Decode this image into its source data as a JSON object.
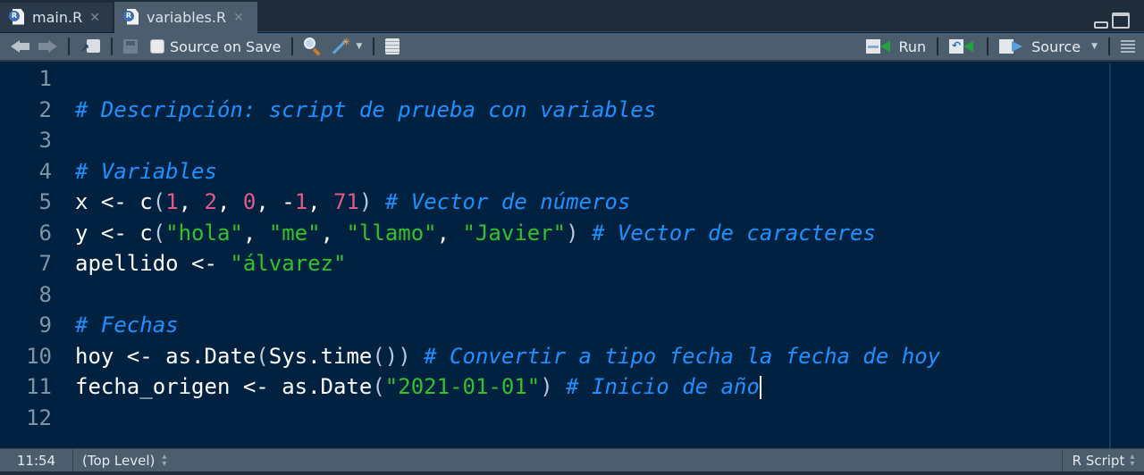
{
  "tabs": [
    {
      "label": "main.R",
      "active": false,
      "icon": "r-file-icon"
    },
    {
      "label": "variables.R",
      "active": true,
      "icon": "r-file-icon"
    }
  ],
  "toolbar": {
    "source_on_save_label": "Source on Save",
    "source_on_save_checked": false,
    "run_label": "Run",
    "source_label": "Source"
  },
  "editor": {
    "lines": [
      {
        "n": "1",
        "tokens": []
      },
      {
        "n": "2",
        "tokens": [
          {
            "t": "com",
            "v": "# Descripción: script de prueba con variables"
          }
        ]
      },
      {
        "n": "3",
        "tokens": []
      },
      {
        "n": "4",
        "tokens": [
          {
            "t": "com",
            "v": "# Variables"
          }
        ]
      },
      {
        "n": "5",
        "tokens": [
          {
            "t": "id",
            "v": "x <- c"
          },
          {
            "t": "paren",
            "v": "("
          },
          {
            "t": "num",
            "v": "1"
          },
          {
            "t": "id",
            "v": ", "
          },
          {
            "t": "num",
            "v": "2"
          },
          {
            "t": "id",
            "v": ", "
          },
          {
            "t": "num",
            "v": "0"
          },
          {
            "t": "id",
            "v": ", -"
          },
          {
            "t": "num",
            "v": "1"
          },
          {
            "t": "id",
            "v": ", "
          },
          {
            "t": "num",
            "v": "71"
          },
          {
            "t": "paren",
            "v": ")"
          },
          {
            "t": "id",
            "v": " "
          },
          {
            "t": "com",
            "v": "# Vector de números"
          }
        ]
      },
      {
        "n": "6",
        "tokens": [
          {
            "t": "id",
            "v": "y <- c"
          },
          {
            "t": "paren",
            "v": "("
          },
          {
            "t": "str",
            "v": "\"hola\""
          },
          {
            "t": "id",
            "v": ", "
          },
          {
            "t": "str",
            "v": "\"me\""
          },
          {
            "t": "id",
            "v": ", "
          },
          {
            "t": "str",
            "v": "\"llamo\""
          },
          {
            "t": "id",
            "v": ", "
          },
          {
            "t": "str",
            "v": "\"Javier\""
          },
          {
            "t": "paren",
            "v": ")"
          },
          {
            "t": "id",
            "v": " "
          },
          {
            "t": "com",
            "v": "# Vector de caracteres"
          }
        ]
      },
      {
        "n": "7",
        "tokens": [
          {
            "t": "id",
            "v": "apellido <- "
          },
          {
            "t": "str",
            "v": "\"álvarez\""
          }
        ]
      },
      {
        "n": "8",
        "tokens": []
      },
      {
        "n": "9",
        "tokens": [
          {
            "t": "com",
            "v": "# Fechas"
          }
        ]
      },
      {
        "n": "10",
        "tokens": [
          {
            "t": "id",
            "v": "hoy <- as.Date"
          },
          {
            "t": "paren",
            "v": "("
          },
          {
            "t": "id",
            "v": "Sys.time"
          },
          {
            "t": "paren",
            "v": "())"
          },
          {
            "t": "id",
            "v": " "
          },
          {
            "t": "com",
            "v": "# Convertir a tipo fecha la fecha de hoy"
          }
        ]
      },
      {
        "n": "11",
        "tokens": [
          {
            "t": "id",
            "v": "fecha_origen <- as.Date"
          },
          {
            "t": "paren",
            "v": "("
          },
          {
            "t": "str",
            "v": "\"2021-01-01\""
          },
          {
            "t": "paren",
            "v": ")"
          },
          {
            "t": "id",
            "v": " "
          },
          {
            "t": "com",
            "v": "# Inicio de año"
          },
          {
            "t": "cursor",
            "v": ""
          }
        ]
      },
      {
        "n": "12",
        "tokens": []
      }
    ]
  },
  "statusbar": {
    "cursor_position": "11:54",
    "scope": "(Top Level)",
    "file_type": "R Script"
  }
}
